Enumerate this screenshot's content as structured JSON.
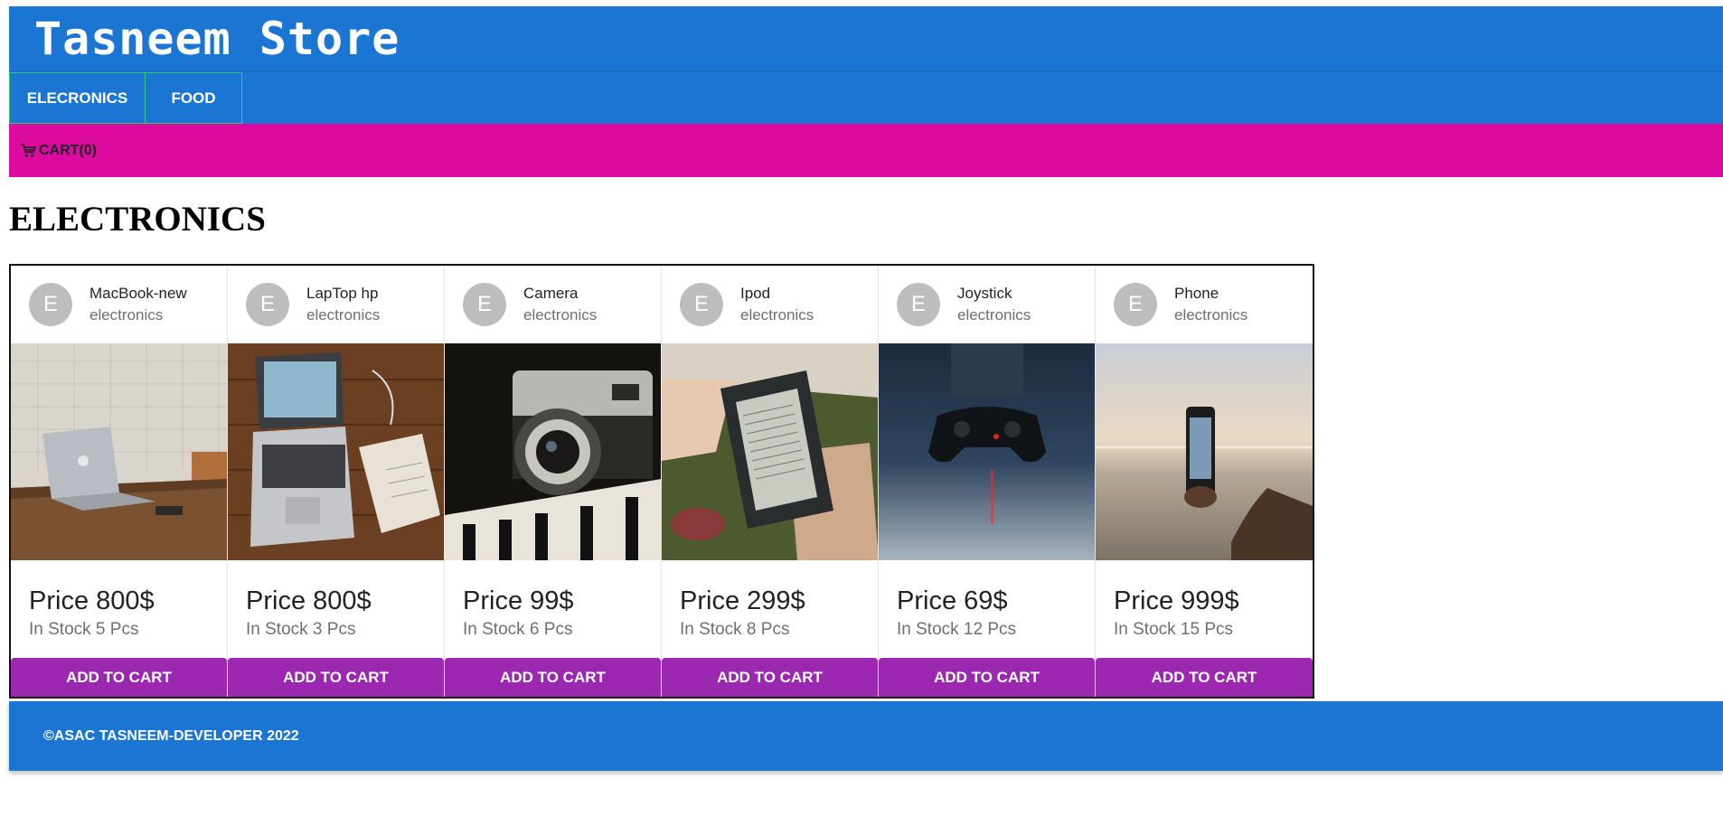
{
  "header": {
    "title": "Tasneem Store"
  },
  "nav": {
    "tabs": [
      {
        "label": "ELECRONICS"
      },
      {
        "label": "FOOD"
      }
    ]
  },
  "cart": {
    "label": "CART(0)",
    "icon": "cart-icon"
  },
  "section": {
    "title": "ELECTRONICS"
  },
  "products": [
    {
      "avatar": "E",
      "name": "MacBook-new",
      "category": "electronics",
      "price": "Price 800$",
      "stock": "In Stock 5 Pcs",
      "button": "ADD TO CART"
    },
    {
      "avatar": "E",
      "name": "LapTop hp",
      "category": "electronics",
      "price": "Price 800$",
      "stock": "In Stock 3 Pcs",
      "button": "ADD TO CART"
    },
    {
      "avatar": "E",
      "name": "Camera",
      "category": "electronics",
      "price": "Price 99$",
      "stock": "In Stock 6 Pcs",
      "button": "ADD TO CART"
    },
    {
      "avatar": "E",
      "name": "Ipod",
      "category": "electronics",
      "price": "Price 299$",
      "stock": "In Stock 8 Pcs",
      "button": "ADD TO CART"
    },
    {
      "avatar": "E",
      "name": "Joystick",
      "category": "electronics",
      "price": "Price 69$",
      "stock": "In Stock 12 Pcs",
      "button": "ADD TO CART"
    },
    {
      "avatar": "E",
      "name": "Phone",
      "category": "electronics",
      "price": "Price 999$",
      "stock": "In Stock 15 Pcs",
      "button": "ADD TO CART"
    }
  ],
  "footer": {
    "text": "©ASAC TASNEEM-DEVELOPER 2022"
  },
  "colors": {
    "primary": "#1b76d3",
    "cartbar": "#dc0a9f",
    "button": "#9c27b0",
    "tab_border": "#2ecc71"
  }
}
